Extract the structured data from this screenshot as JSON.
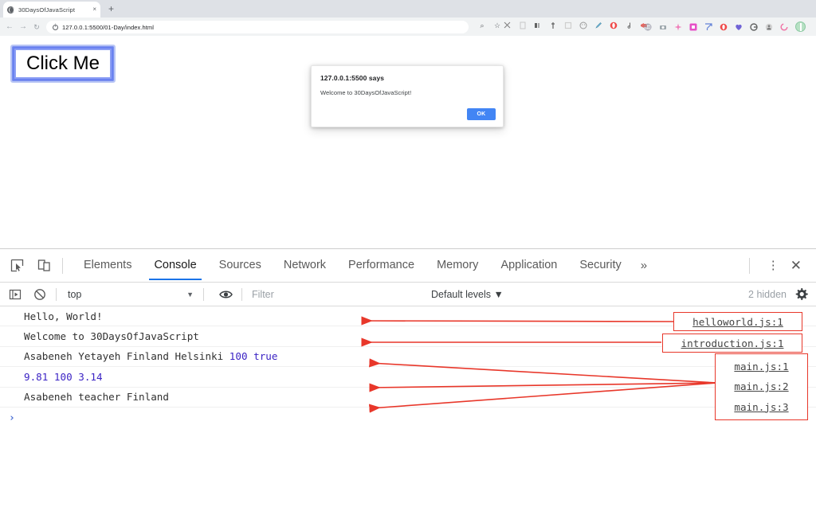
{
  "browser": {
    "tab": {
      "title": "30DaysOfJavaScript",
      "favicon": "globe-icon",
      "close": "×"
    },
    "new_tab": "+",
    "nav": {
      "back": "←",
      "forward": "→",
      "reload": "↻"
    },
    "omnibox": {
      "url": "127.0.0.1:5500/01-Day/index.html",
      "site_info_icon": "info-circle-icon"
    },
    "menu": "⋮"
  },
  "page": {
    "button_label": "Click Me"
  },
  "alert": {
    "title": "127.0.0.1:5500 says",
    "message": "Welcome to 30DaysOfJavaScript!",
    "ok_label": "OK"
  },
  "devtools": {
    "tabs": [
      {
        "label": "Elements",
        "active": false
      },
      {
        "label": "Console",
        "active": true
      },
      {
        "label": "Sources",
        "active": false
      },
      {
        "label": "Network",
        "active": false
      },
      {
        "label": "Performance",
        "active": false
      },
      {
        "label": "Memory",
        "active": false
      },
      {
        "label": "Application",
        "active": false
      },
      {
        "label": "Security",
        "active": false
      }
    ],
    "overflow": "»",
    "kebab": "⋮",
    "close": "✕",
    "console_toolbar": {
      "context": "top",
      "context_caret": "▼",
      "filter_placeholder": "Filter",
      "filter_value": "",
      "levels": "Default levels ▼",
      "hidden_count": "2 hidden"
    },
    "messages": [
      {
        "text": "Hello, World!",
        "source": "helloworld.js:1"
      },
      {
        "text": "Welcome to 30DaysOfJavaScript",
        "source": "introduction.js:1"
      },
      {
        "text": "Asabeneh Yetayeh Finland Helsinki ",
        "numeric": "100 true",
        "source": "main.js:1"
      },
      {
        "text": "",
        "numeric": "9.81 100 3.14",
        "source": "main.js:2"
      },
      {
        "text": "Asabeneh teacher Finland",
        "source": "main.js:3"
      }
    ],
    "prompt_caret": "›"
  },
  "annotation": {
    "color": "#e8372a"
  }
}
